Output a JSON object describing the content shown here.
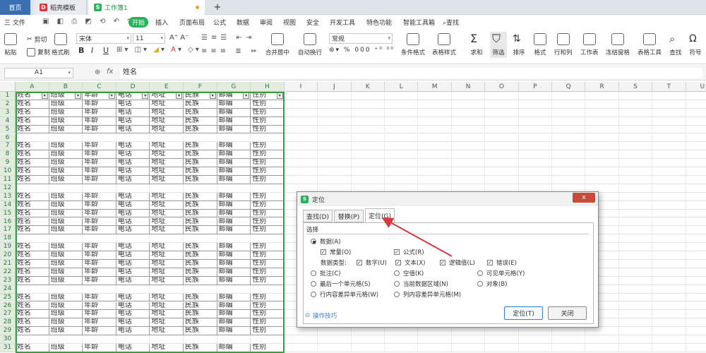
{
  "tabs": {
    "home": "首页",
    "template": "稻壳模板",
    "workbook": "工作簿1",
    "new_tab": "+"
  },
  "menu": {
    "file": "三 文件",
    "start": "开始",
    "items": [
      "插入",
      "页面布局",
      "公式",
      "数据",
      "审阅",
      "视图",
      "安全",
      "开发工具",
      "特色功能",
      "智能工具箱"
    ],
    "search": "查找"
  },
  "ribbon": {
    "paste": "粘贴",
    "cut": "剪切",
    "copy": "复制",
    "format_painter": "格式刷",
    "font_name": "宋体",
    "font_size": "11",
    "bold": "B",
    "italic": "I",
    "underline": "U",
    "merge_center": "合并居中",
    "wrap_text": "自动换行",
    "number_format": "常规",
    "percent": "%",
    "thousands": "000",
    "cond_format": "条件格式",
    "table_style": "表格样式",
    "sum": "求和",
    "filter": "筛选",
    "sort": "排序",
    "format": "格式",
    "row_col": "行和列",
    "worksheet": "工作表",
    "freeze": "冻结窗格",
    "table_tools": "表格工具",
    "find": "查找",
    "symbol": "符号"
  },
  "formula_bar": {
    "cell_ref": "A1",
    "fx": "fx",
    "content": "姓名"
  },
  "sheet": {
    "columns": [
      "A",
      "B",
      "C",
      "D",
      "E",
      "F",
      "G",
      "H",
      "I",
      "J",
      "K",
      "L",
      "M",
      "N",
      "O",
      "P",
      "Q",
      "R",
      "S",
      "T",
      "U"
    ],
    "rows": [
      "1",
      "2",
      "3",
      "4",
      "5",
      "6",
      "7",
      "8",
      "9",
      "10",
      "11",
      "12",
      "13",
      "14",
      "15",
      "16",
      "17",
      "18",
      "19",
      "20",
      "21",
      "22",
      "23",
      "24",
      "25",
      "26",
      "27",
      "28",
      "29",
      "30",
      "31"
    ],
    "header_values": [
      "姓名",
      "班级",
      "年龄",
      "电话",
      "地址",
      "民族",
      "邮编",
      "性别"
    ],
    "blank_rows": [
      "6",
      "12",
      "18",
      "24",
      "30"
    ]
  },
  "dialog": {
    "title": "定位",
    "close": "x",
    "tabs": [
      "查找(D)",
      "替换(P)",
      "定位(G)"
    ],
    "section": "选择",
    "data": "数据(A)",
    "constant": "常量(O)",
    "formula": "公式(R)",
    "data_type": "数据类型:",
    "number": "数字(U)",
    "text": "文本(X)",
    "logical": "逻辑值(L)",
    "error": "错误(E)",
    "comment": "批注(C)",
    "blank": "空值(K)",
    "visible": "可见单元格(Y)",
    "last_cell": "最后一个单元格(S)",
    "current_region": "当前数据区域(N)",
    "object": "对象(B)",
    "row_diff": "行内容差异单元格(W)",
    "col_diff": "列内容差异单元格(M)",
    "tips": "操作技巧",
    "locate": "定位(T)",
    "close_btn": "关闭"
  },
  "colors": {
    "accent_green": "#2bb15a",
    "selection_border": "#3f9b47",
    "arrow": "#d9363e",
    "tab_blue": "#3b6fb3"
  }
}
